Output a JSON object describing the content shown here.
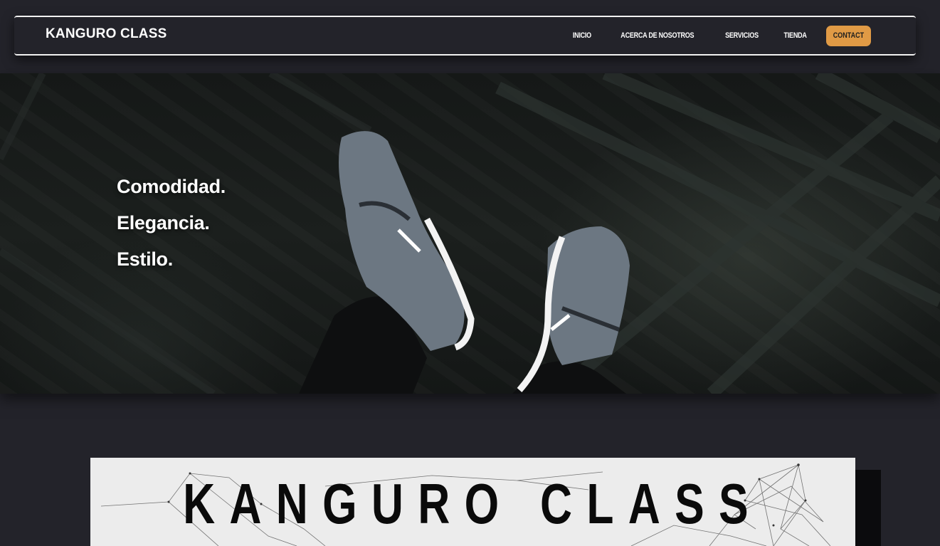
{
  "brand": "KANGURO CLASS",
  "nav": {
    "links": [
      "INICIO",
      "ACERCA DE NOSOTROS",
      "SERVICIOS",
      "TIENDA"
    ],
    "contact": "CONTACT"
  },
  "hero": {
    "lines": [
      "Comodidad.",
      "Elegancia.",
      "Estilo."
    ],
    "image_icon": "sneakers-photo"
  },
  "banner": {
    "title": "KANGURO CLASS"
  },
  "colors": {
    "background": "#23232a",
    "accent": "#e09a45",
    "banner_bg": "#ececec"
  }
}
